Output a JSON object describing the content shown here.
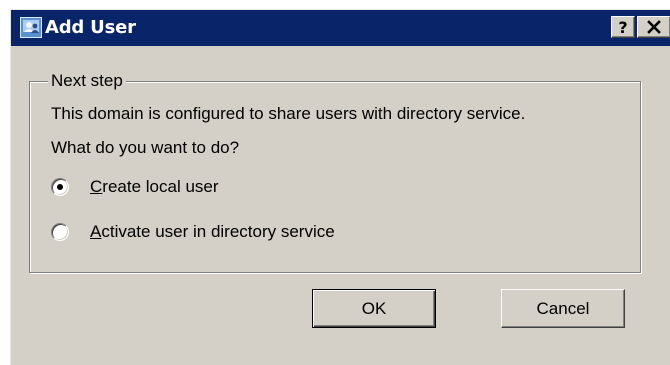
{
  "window": {
    "title": "Add User",
    "icon": "add-user-app-icon",
    "help_button": "?",
    "close_button": "✕",
    "colors": {
      "titlebar": "#0a246a",
      "face": "#d4d0c8"
    }
  },
  "group": {
    "legend": "Next step",
    "description": "This domain is configured to share users with directory service.",
    "question": "What do you want to do?",
    "options": [
      {
        "mnemonic": "C",
        "rest": "reate local user",
        "selected": true
      },
      {
        "mnemonic": "A",
        "rest": "ctivate user in directory service",
        "selected": false
      }
    ]
  },
  "buttons": {
    "ok": "OK",
    "cancel": "Cancel"
  }
}
